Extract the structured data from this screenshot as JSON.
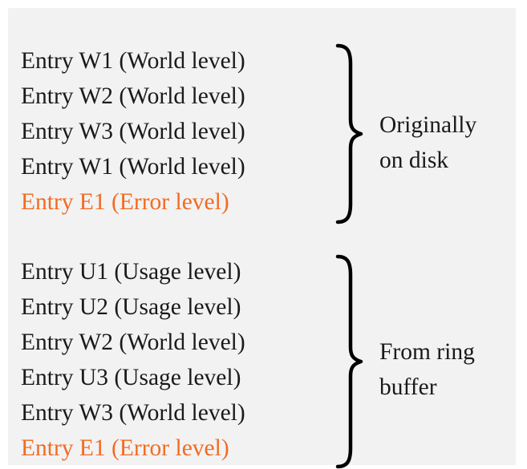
{
  "groups": {
    "disk": {
      "entries": [
        {
          "text": "Entry W1 (World level)",
          "kind": "world"
        },
        {
          "text": "Entry W2 (World level)",
          "kind": "world"
        },
        {
          "text": "Entry W3 (World level)",
          "kind": "world"
        },
        {
          "text": "Entry W1 (World level)",
          "kind": "world"
        },
        {
          "text": "Entry E1 (Error level)",
          "kind": "error"
        }
      ],
      "caption": [
        "Originally",
        "on disk"
      ]
    },
    "ring": {
      "entries": [
        {
          "text": "Entry U1 (Usage level)",
          "kind": "usage"
        },
        {
          "text": "Entry U2 (Usage level)",
          "kind": "usage"
        },
        {
          "text": "Entry W2 (World level)",
          "kind": "world"
        },
        {
          "text": "Entry U3 (Usage level)",
          "kind": "usage"
        },
        {
          "text": "Entry W3 (World level)",
          "kind": "world"
        },
        {
          "text": "Entry E1 (Error level)",
          "kind": "error"
        }
      ],
      "caption": [
        "From ring",
        "buffer"
      ]
    }
  },
  "colors": {
    "background_panel": "#f2f2f2",
    "text": "#1a1a1a",
    "error": "#f26b21",
    "brace": "#000000"
  }
}
